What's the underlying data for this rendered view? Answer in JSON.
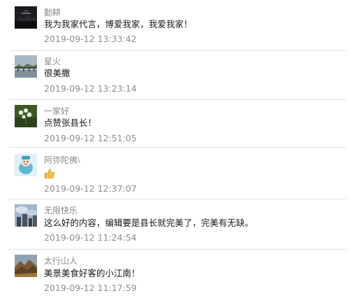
{
  "comments": [
    {
      "username": "勤耕",
      "avatar_icon": "dark-night-landscape-avatar",
      "text": "我为我家代言，博爱我家，我爱我家！",
      "timestamp": "2019-09-12 13:33:42"
    },
    {
      "username": "星火",
      "avatar_icon": "bridge-over-water-avatar",
      "text": "很美撒",
      "timestamp": "2019-09-12 13:23:14"
    },
    {
      "username": "一家好",
      "avatar_icon": "white-flower-avatar",
      "text": "点赞张县长！",
      "timestamp": "2019-09-12 12:51:05"
    },
    {
      "username": "阿弥陀佛",
      "avatar_icon": "cartoon-character-avatar",
      "text": "",
      "emoji": "thumbs-up",
      "timestamp": "2019-09-12 12:37:07"
    },
    {
      "username": "无限快乐",
      "avatar_icon": "sky-and-buildings-avatar",
      "text": "这么好的内容，编辑要是县长就完美了，完美有无缺。",
      "timestamp": "2019-09-12 11:24:54"
    },
    {
      "username": "太行山人",
      "avatar_icon": "mountain-landscape-avatar",
      "text": "美景美食好客的小江南！",
      "timestamp": "2019-09-12 11:17:59"
    }
  ]
}
